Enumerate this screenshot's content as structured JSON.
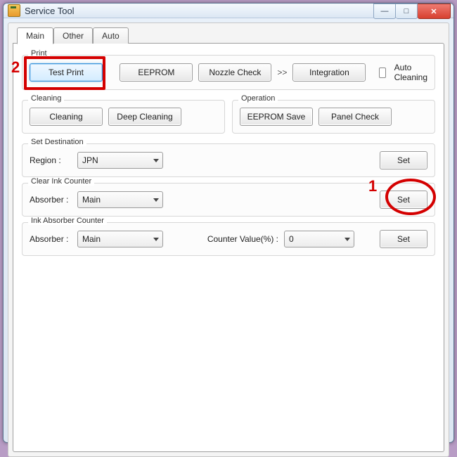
{
  "window": {
    "title": "Service Tool",
    "minimize_glyph": "—",
    "maximize_glyph": "□",
    "close_glyph": "✕"
  },
  "tabs": {
    "main": "Main",
    "other": "Other",
    "auto": "Auto"
  },
  "print": {
    "title": "Print",
    "test_print": "Test Print",
    "eeprom": "EEPROM",
    "nozzle_check": "Nozzle Check",
    "arrows": ">>",
    "integration": "Integration",
    "auto_cleaning": "Auto Cleaning"
  },
  "cleaning": {
    "title": "Cleaning",
    "cleaning": "Cleaning",
    "deep_cleaning": "Deep Cleaning"
  },
  "operation": {
    "title": "Operation",
    "eeprom_save": "EEPROM Save",
    "panel_check": "Panel Check"
  },
  "set_destination": {
    "title": "Set Destination",
    "region_label": "Region :",
    "region_value": "JPN",
    "set": "Set"
  },
  "clear_ink": {
    "title": "Clear Ink Counter",
    "absorber_label": "Absorber :",
    "absorber_value": "Main",
    "set": "Set"
  },
  "ink_absorber": {
    "title": "Ink Absorber Counter",
    "absorber_label": "Absorber :",
    "absorber_value": "Main",
    "counter_label": "Counter Value(%) :",
    "counter_value": "0",
    "set": "Set"
  },
  "annotations": {
    "one": "1",
    "two": "2"
  }
}
